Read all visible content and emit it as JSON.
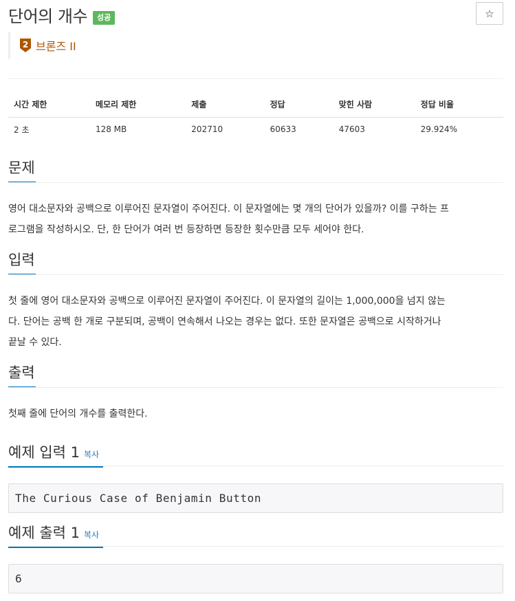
{
  "problem": {
    "title": "단어의 개수",
    "result_badge": "성공",
    "star_icon": "☆",
    "tier": {
      "level": "2",
      "label": "브론즈 II",
      "color": "#ad5600"
    }
  },
  "info_table": {
    "headers": [
      "시간 제한",
      "메모리 제한",
      "제출",
      "정답",
      "맞힌 사람",
      "정답 비율"
    ],
    "values": [
      "2 초",
      "128 MB",
      "202710",
      "60633",
      "47603",
      "29.924%"
    ]
  },
  "sections": {
    "problem": {
      "heading": "문제",
      "lines": [
        "영어 대소문자와 공백으로 이루어진 문자열이 주어진다. 이 문자열에는 몇 개의 단어가 있을까? 이를 구하는 프",
        "로그램을 작성하시오. 단, 한 단어가 여러 번 등장하면 등장한 횟수만큼 모두 세어야 한다."
      ]
    },
    "input": {
      "heading": "입력",
      "lines": [
        "첫 줄에 영어 대소문자와 공백으로 이루어진 문자열이 주어진다. 이 문자열의 길이는 1,000,000을 넘지 않는",
        "다. 단어는 공백 한 개로 구분되며, 공백이 연속해서 나오는 경우는 없다. 또한 문자열은 공백으로 시작하거나",
        "끝날 수 있다."
      ]
    },
    "output": {
      "heading": "출력",
      "lines": [
        "첫째 줄에 단어의 개수를 출력한다."
      ]
    },
    "sample_input": {
      "heading": "예제 입력 1",
      "copy": "복사",
      "content": "The Curious Case of Benjamin Button"
    },
    "sample_output": {
      "heading": "예제 출력 1",
      "copy": "복사",
      "content": "6"
    }
  },
  "colors": {
    "accent": "#0076c0",
    "success": "#5cb85c",
    "bronze": "#ad5600"
  }
}
